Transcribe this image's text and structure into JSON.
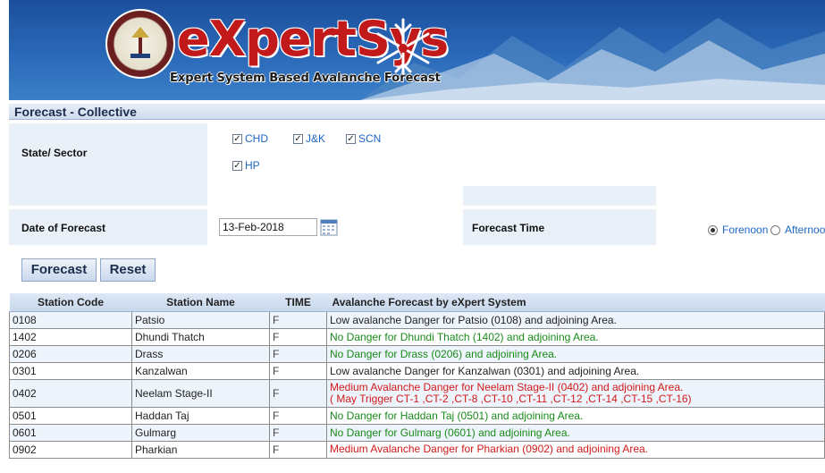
{
  "banner": {
    "brand": "eXpertSys",
    "tagline": "Expert System Based Avalanche Forecast"
  },
  "section_title": "Forecast - Collective",
  "state_sector": {
    "label": "State/ Sector",
    "options": [
      {
        "label": "CHD",
        "checked": true
      },
      {
        "label": "J&K",
        "checked": true
      },
      {
        "label": "SCN",
        "checked": true
      },
      {
        "label": "HP",
        "checked": true
      }
    ]
  },
  "date_of_forecast": {
    "label": "Date of Forecast",
    "value": "13-Feb-2018"
  },
  "forecast_time": {
    "label": "Forecast Time",
    "options": [
      {
        "label": "Forenoon",
        "selected": true
      },
      {
        "label": "Afternoon",
        "selected": false
      }
    ]
  },
  "buttons": {
    "forecast": "Forecast",
    "reset": "Reset"
  },
  "table": {
    "headers": [
      "Station Code",
      "Station Name",
      "TIME",
      "Avalanche Forecast by eXpert System"
    ],
    "rows": [
      {
        "code": "0108",
        "name": "Patsio",
        "time": "F",
        "forecast": "Low avalanche Danger for Patsio (0108) and adjoining Area.",
        "level": "low"
      },
      {
        "code": "1402",
        "name": "Dhundi Thatch",
        "time": "F",
        "forecast": "No Danger for Dhundi Thatch (1402) and adjoining Area.",
        "level": "none"
      },
      {
        "code": "0206",
        "name": "Drass",
        "time": "F",
        "forecast": "No Danger for Drass (0206) and adjoining Area.",
        "level": "none"
      },
      {
        "code": "0301",
        "name": "Kanzalwan",
        "time": "F",
        "forecast": "Low avalanche Danger for Kanzalwan (0301) and adjoining Area.",
        "level": "low"
      },
      {
        "code": "0402",
        "name": "Neelam Stage-II",
        "time": "F",
        "forecast": "Medium Avalanche Danger for Neelam Stage-II (0402) and adjoining Area.",
        "forecast_line2": "( May Trigger CT-1 ,CT-2 ,CT-8 ,CT-10 ,CT-11 ,CT-12 ,CT-14 ,CT-15 ,CT-16)",
        "level": "medium"
      },
      {
        "code": "0501",
        "name": "Haddan Taj",
        "time": "F",
        "forecast": "No Danger for Haddan Taj (0501) and adjoining Area.",
        "level": "none"
      },
      {
        "code": "0601",
        "name": "Gulmarg",
        "time": "F",
        "forecast": "No Danger for Gulmarg (0601) and adjoining Area.",
        "level": "none"
      },
      {
        "code": "0902",
        "name": "Pharkian",
        "time": "F",
        "forecast": "Medium Avalanche Danger for Pharkian (0902) and adjoining Area.",
        "level": "medium"
      }
    ]
  },
  "colors": {
    "banner_blue": "#2a69b8",
    "brand_red": "#c21a1a",
    "low": "#222222",
    "none": "#1a8a1a",
    "medium": "#d21a1a"
  }
}
